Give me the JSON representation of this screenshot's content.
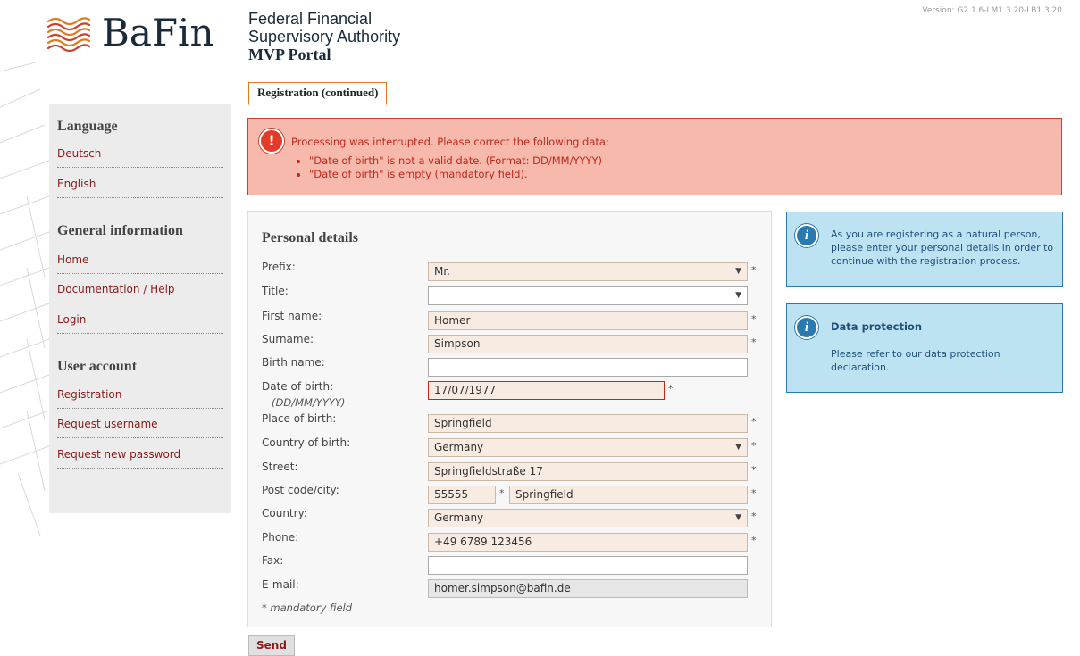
{
  "version": "Version: G2.1.6-LM1.3.20-LB1.3.20",
  "header": {
    "logo_text": "BaFin",
    "org_line1": "Federal Financial",
    "org_line2": "Supervisory Authority",
    "portal": "MVP Portal"
  },
  "tab": {
    "label": "Registration (continued)"
  },
  "sidebar": {
    "language_heading": "Language",
    "language_items": [
      "Deutsch",
      "English"
    ],
    "general_heading": "General information",
    "general_items": [
      "Home",
      "Documentation / Help",
      "Login"
    ],
    "account_heading": "User account",
    "account_items": [
      "Registration",
      "Request username",
      "Request new password"
    ]
  },
  "error": {
    "icon": "exclamation-icon",
    "title": "Processing was interrupted. Please correct the following data:",
    "items": [
      "\"Date of birth\" is not a valid date. (Format: DD/MM/YYYY)",
      "\"Date of birth\" is empty (mandatory field)."
    ]
  },
  "form": {
    "heading": "Personal details",
    "prefix_label": "Prefix:",
    "prefix_value": "Mr.",
    "title_label": "Title:",
    "title_value": "",
    "first_name_label": "First name:",
    "first_name_value": "Homer",
    "surname_label": "Surname:",
    "surname_value": "Simpson",
    "birth_name_label": "Birth name:",
    "birth_name_value": "",
    "dob_label": "Date of birth:",
    "dob_hint": "(DD/MM/YYYY)",
    "dob_value": "17/07/1977",
    "place_of_birth_label": "Place of birth:",
    "place_of_birth_value": "Springfield",
    "country_of_birth_label": "Country of birth:",
    "country_of_birth_value": "Germany",
    "street_label": "Street:",
    "street_value": "Springfieldstraße 17",
    "postcode_label": "Post code/city:",
    "postcode_value": "55555",
    "city_value": "Springfield",
    "country_label": "Country:",
    "country_value": "Germany",
    "phone_label": "Phone:",
    "phone_value": "+49 6789 123456",
    "fax_label": "Fax:",
    "fax_value": "",
    "email_label": "E-mail:",
    "email_value": "homer.simpson@bafin.de",
    "mandatory_note": "* mandatory field",
    "required_marker": "*",
    "caret": "▼"
  },
  "send_label": "Send",
  "info_registration": {
    "icon": "info-icon",
    "text": "As you are registering as a natural person, please enter your personal details in order to continue with the registration process."
  },
  "info_data_protection": {
    "icon": "info-icon",
    "title": "Data protection",
    "text": "Please refer to our data protection declaration."
  },
  "colors": {
    "accent": "#e07a1c",
    "link": "#8b1a1a",
    "error_bg": "#f6b9ac",
    "info_bg": "#bde3f3",
    "field_bg": "#f8ece2"
  }
}
